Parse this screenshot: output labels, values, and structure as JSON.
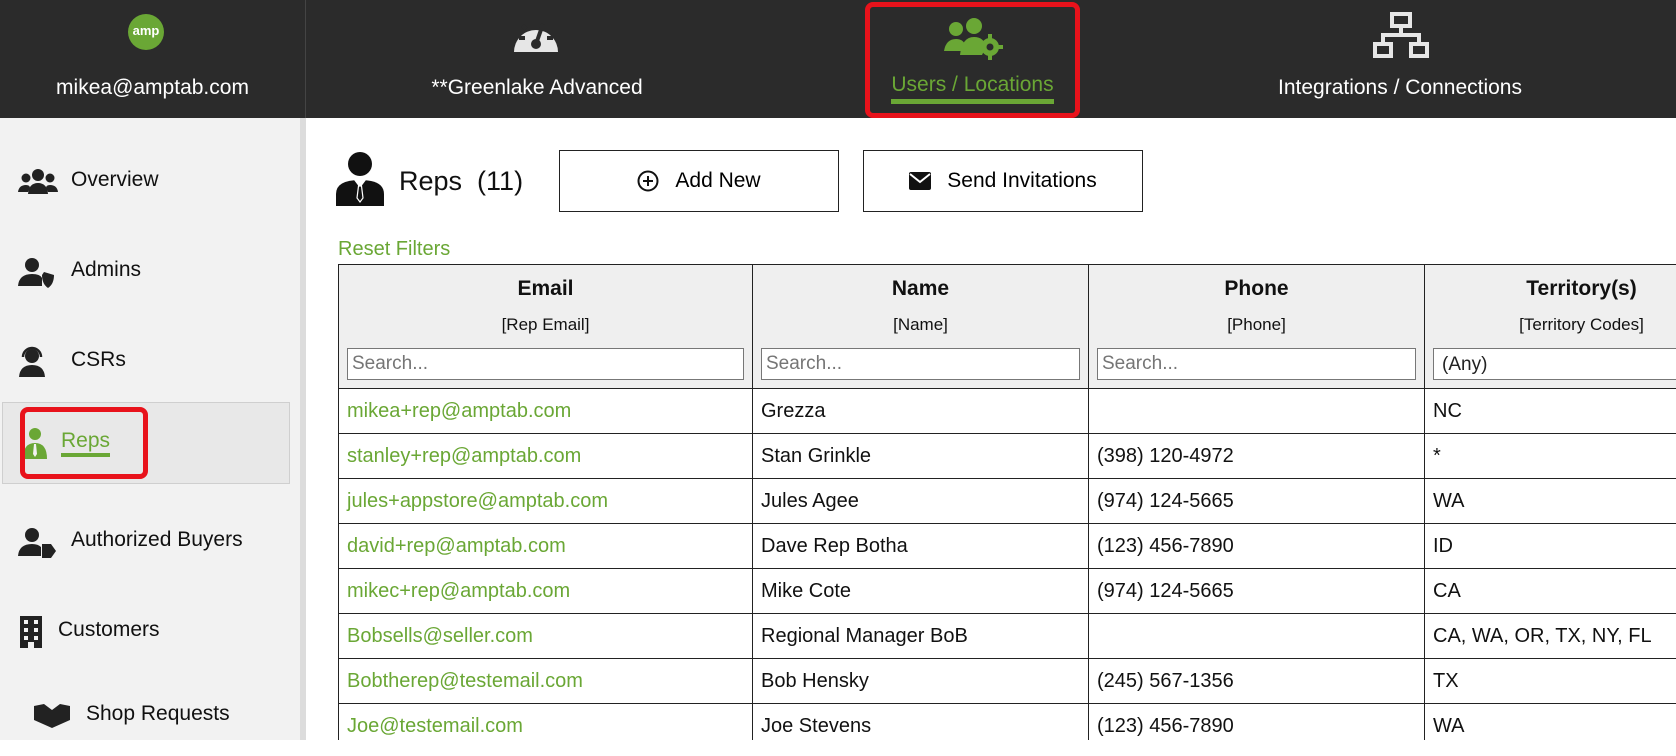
{
  "top_nav": {
    "account": {
      "logo_text": "amp",
      "email": "mikea@amptab.com"
    },
    "org": {
      "label": "**Greenlake Advanced"
    },
    "users": {
      "label": "Users / Locations",
      "active": true
    },
    "integrations": {
      "label": "Integrations / Connections"
    }
  },
  "sidebar": {
    "items": [
      {
        "label": "Overview",
        "icon": "users-icon"
      },
      {
        "label": "Admins",
        "icon": "user-shield-icon"
      },
      {
        "label": "CSRs",
        "icon": "headset-icon"
      },
      {
        "label": "Reps",
        "icon": "user-tie-icon",
        "active": true
      },
      {
        "label": "Authorized Buyers",
        "icon": "user-tag-icon"
      },
      {
        "label": "Customers",
        "icon": "building-icon"
      },
      {
        "label": "Shop Requests",
        "icon": "handshake-icon"
      }
    ]
  },
  "main": {
    "title": "Reps",
    "count": "(11)",
    "add_new_label": "Add New",
    "send_invitations_label": "Send Invitations",
    "reset_filters_label": "Reset Filters",
    "columns": [
      {
        "title": "Email",
        "subtitle": "[Rep Email]",
        "placeholder": "Search..."
      },
      {
        "title": "Name",
        "subtitle": "[Name]",
        "placeholder": "Search..."
      },
      {
        "title": "Phone",
        "subtitle": "[Phone]",
        "placeholder": "Search..."
      },
      {
        "title": "Territory(s)",
        "subtitle": "[Territory Codes]",
        "select_value": "(Any)"
      }
    ],
    "rows": [
      {
        "email": "mikea+rep@amptab.com",
        "name": "Grezza",
        "phone": "",
        "territory": "NC"
      },
      {
        "email": "stanley+rep@amptab.com",
        "name": "Stan Grinkle",
        "phone": "(398) 120-4972",
        "territory": "*"
      },
      {
        "email": "jules+appstore@amptab.com",
        "name": "Jules Agee",
        "phone": "(974) 124-5665",
        "territory": "WA"
      },
      {
        "email": "david+rep@amptab.com",
        "name": "Dave Rep Botha",
        "phone": "(123) 456-7890",
        "territory": "ID"
      },
      {
        "email": "mikec+rep@amptab.com",
        "name": "Mike Cote",
        "phone": "(974) 124-5665",
        "territory": "CA"
      },
      {
        "email": "Bobsells@seller.com",
        "name": "Regional Manager BoB",
        "phone": "",
        "territory": "CA, WA, OR, TX, NY, FL"
      },
      {
        "email": "Bobtherep@testemail.com",
        "name": "Bob Hensky",
        "phone": "(245) 567-1356",
        "territory": "TX"
      },
      {
        "email": "Joe@testemail.com",
        "name": "Joe Stevens",
        "phone": "(123) 456-7890",
        "territory": "WA"
      }
    ]
  },
  "colors": {
    "accent": "#6aa735",
    "nav_bg": "#2b2b2b",
    "highlight": "#e8121b"
  }
}
